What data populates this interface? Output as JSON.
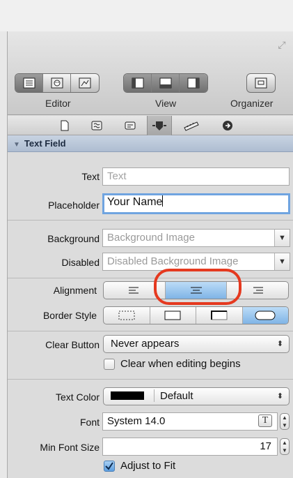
{
  "toolbar": {
    "editor_label": "Editor",
    "view_label": "View",
    "organizer_label": "Organizer"
  },
  "section": {
    "title": "Text Field"
  },
  "fields": {
    "text": {
      "label": "Text",
      "placeholder": "Text"
    },
    "placeholder": {
      "label": "Placeholder",
      "value": "Your Name"
    },
    "background": {
      "label": "Background",
      "placeholder": "Background Image"
    },
    "disabled": {
      "label": "Disabled",
      "placeholder": "Disabled Background Image"
    },
    "alignment": {
      "label": "Alignment",
      "selected": "center"
    },
    "border_style": {
      "label": "Border Style",
      "selected": "rounded"
    },
    "clear_button": {
      "label": "Clear Button",
      "value": "Never appears"
    },
    "clear_when_editing": {
      "label": "Clear when editing begins",
      "checked": false
    },
    "text_color": {
      "label": "Text Color",
      "value": "Default",
      "swatch": "#000000"
    },
    "font": {
      "label": "Font",
      "value": "System 14.0"
    },
    "min_font_size": {
      "label": "Min Font Size",
      "value": "17"
    },
    "adjust_to_fit": {
      "label": "Adjust to Fit",
      "checked": true
    }
  },
  "colors": {
    "highlight": "#e5391f",
    "selected_segment": "#7fb4e6",
    "section_header": "#aebdd1"
  }
}
